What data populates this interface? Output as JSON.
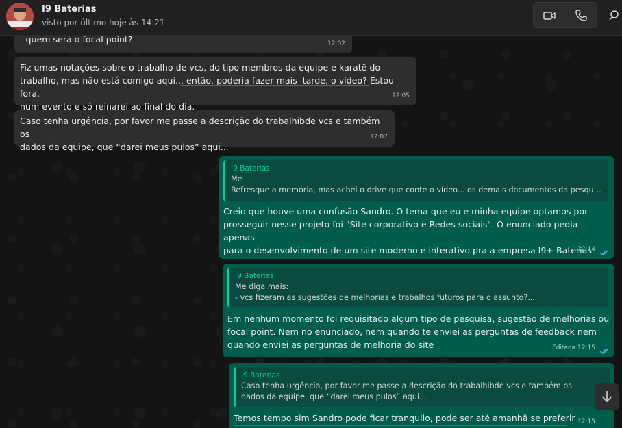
{
  "header": {
    "contact_name": "I9 Baterias",
    "last_seen": "visto por último hoje às 14:21",
    "icons": {
      "video": "video-camera-icon",
      "phone": "phone-icon",
      "search": "search-icon"
    }
  },
  "messages": [
    {
      "direction": "in",
      "text": "- quem será o focal point?",
      "time": "12:02"
    },
    {
      "direction": "in",
      "text_part1": "Fiz umas notações sobre o trabalho de vcs, do tipo membros da equipe e karatê do\ntrabalho, mas não está comigo aqui... ",
      "text_part2": "então, poderia fazer mais  tarde, o vídeo?",
      "text_part3": " Estou fora,\nnum evento e só reinarei ao final do dia.",
      "time": "12:05"
    },
    {
      "direction": "in",
      "text": "Caso tenha urgência, por favor me passe a descrição do trabalhibde vcs e também os\ndados da equipe, que “darei meus pulos” aqui...",
      "time": "12:07"
    },
    {
      "direction": "out",
      "quote": {
        "author": "I9 Baterias",
        "line1": "Me",
        "line2": "Refresque a memória, mas achei o drive que conte o vídeo... os demais documentos da pesquisa, qu..."
      },
      "text": "Creio que houve uma confusão Sandro. O tema que eu e minha equipe optamos por\nprosseguir nesse projeto foi \"Site corporativo e Redes sociais\". O enunciado pedia apenas\npara o desenvolvimento de um site moderno e interativo pra a empresa I9+ Baterias",
      "time": "12:14"
    },
    {
      "direction": "out",
      "quote": {
        "author": "I9 Baterias",
        "line1": "Me diga mais:",
        "line2": "- vcs fizeram as sugestões de melhorias e trabalhos futuros para o assunto?..."
      },
      "text": "Em nenhum momento foi requisitado algum tipo de pesquisa, sugestão de melhorias ou\nfocal point. Nem no enunciado, nem quando te enviei as perguntas de feedback nem\nquando enviei as perguntas de melhoria do site",
      "time": "Editada 12:15"
    },
    {
      "direction": "out",
      "quote": {
        "author": "I9 Baterias",
        "line1": "Caso tenha urgência, por favor me passe a descrição do trabalhibde vcs e também os",
        "line2": "dados da equipe, que “darei meus pulos” aqui..."
      },
      "text": "Temos tempo sim Sandro pode ficar tranquilo, pode ser até amanhã se preferir",
      "time": "12:15"
    }
  ],
  "colors": {
    "incoming": "#2e2e2e",
    "outgoing": "#005c4b",
    "accent": "#06cf9c",
    "underline": "#e0302a"
  },
  "scroll_button_icon": "arrow-down-icon"
}
